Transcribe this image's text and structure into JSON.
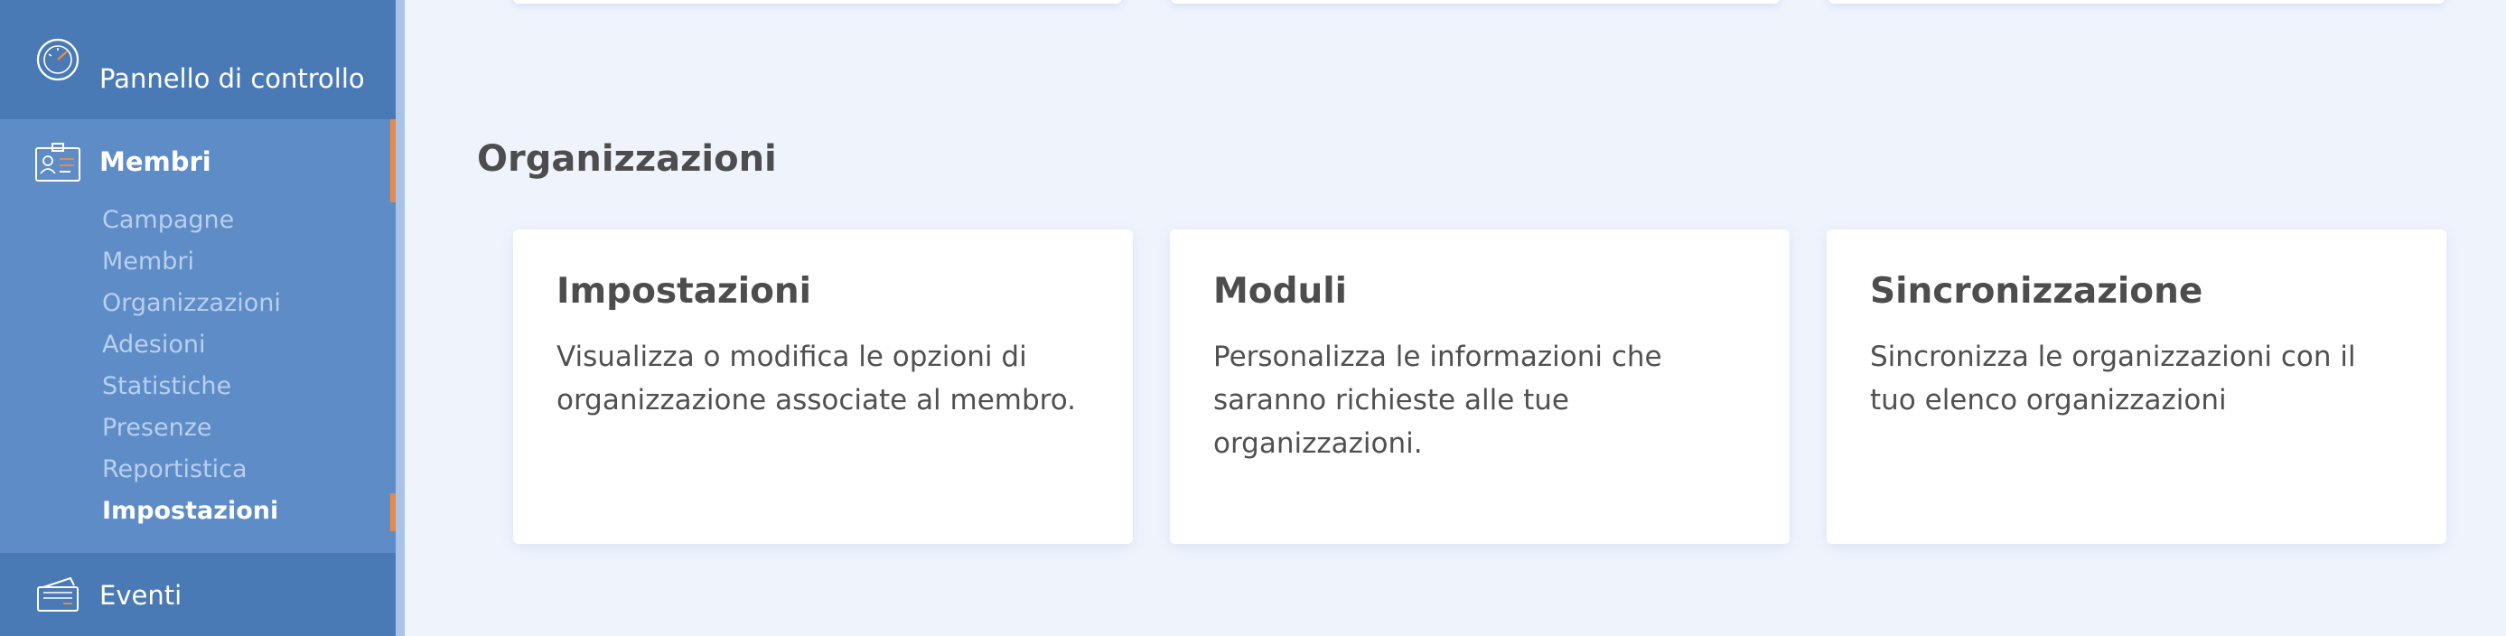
{
  "sidebar": {
    "dashboard": {
      "label": "Pannello di controllo",
      "icon": "speedometer-icon"
    },
    "members": {
      "label": "Membri",
      "icon": "id-badge-icon",
      "items": [
        {
          "label": "Campagne"
        },
        {
          "label": "Membri"
        },
        {
          "label": "Organizzazioni"
        },
        {
          "label": "Adesioni"
        },
        {
          "label": "Statistiche"
        },
        {
          "label": "Presenze"
        },
        {
          "label": "Reportistica"
        },
        {
          "label": "Impostazioni",
          "active": true
        }
      ]
    },
    "events": {
      "label": "Eventi",
      "icon": "tickets-icon"
    }
  },
  "main": {
    "section_title": "Organizzazioni",
    "cards": [
      {
        "title": "Impostazioni",
        "description": "Visualizza o modifica le opzioni di organizzazione associate al membro."
      },
      {
        "title": "Moduli",
        "description": "Personalizza le informazioni che saranno richieste alle tue organizzazioni."
      },
      {
        "title": "Sincronizzazione",
        "description": "Sincronizza le organizzazioni con il tuo elenco organizzazioni"
      }
    ]
  },
  "colors": {
    "sidebar_bg": "#4a7ab5",
    "sidebar_active_bg": "#5d8cc7",
    "accent": "#e8894a",
    "page_bg": "#eff3fc"
  }
}
